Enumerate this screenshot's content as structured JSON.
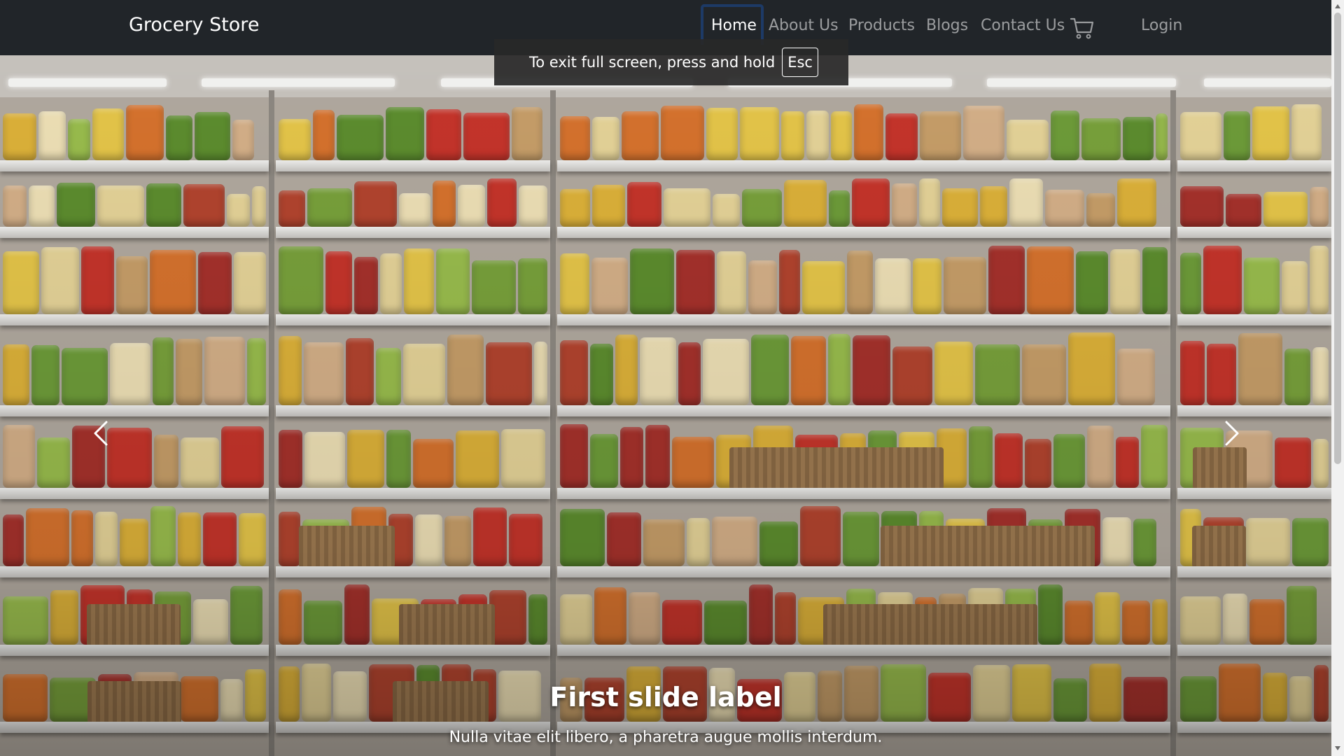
{
  "navbar": {
    "brand": "Grocery Store",
    "links": [
      {
        "label": "Home",
        "active": true
      },
      {
        "label": "About Us",
        "active": false
      },
      {
        "label": "Products",
        "active": false
      },
      {
        "label": "Blogs",
        "active": false
      },
      {
        "label": "Contact Us",
        "active": false
      }
    ],
    "cart_icon": "shopping-cart-icon",
    "login_label": "Login",
    "background_color": "#212529",
    "link_color": "rgba(255,255,255,0.55)",
    "active_link_color": "#ffffff"
  },
  "fullscreen_notice": {
    "text": "To exit full screen, press and hold",
    "key": "Esc"
  },
  "carousel": {
    "slides": [
      {
        "image": "grocery store shelves with produce",
        "caption_title": "First slide label",
        "caption_text": "Nulla vitae elit libero, a pharetra augue mollis interdum."
      }
    ],
    "prev_icon": "chevron-left-icon",
    "next_icon": "chevron-right-icon"
  }
}
